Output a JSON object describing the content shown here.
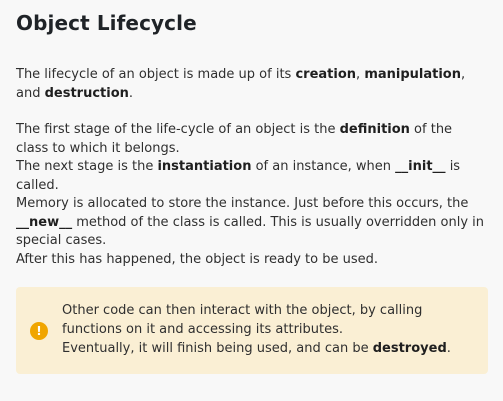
{
  "heading": "Object Lifecycle",
  "intro": {
    "t1": "The lifecycle of an object is made up of its ",
    "b1": "creation",
    "t2": ", ",
    "b2": "manipulation",
    "t3": ", and ",
    "b3": "destruction",
    "t4": "."
  },
  "stages": {
    "s1_t1": "The first stage of the life-cycle of an object is the ",
    "s1_b1": "definition",
    "s1_t2": " of the class to which it belongs.",
    "s2_t1": "The next stage is the ",
    "s2_b1": "instantiation",
    "s2_t2": " of an instance, when ",
    "s2_b2": "__init__",
    "s2_t3": " is called.",
    "s3_t1": "Memory is allocated to store the instance. Just before this occurs, the ",
    "s3_b1": "__new__",
    "s3_t2": " method of the class is called. This is usually overridden only in special cases.",
    "s4": "After this has happened, the object is ready to be used."
  },
  "callout": {
    "icon": "!",
    "icon_name": "warning-icon",
    "icon_color": "#f0a500",
    "background": "#faefd4",
    "l1": "Other code can then interact with the object, by calling functions on it and accessing its attributes.",
    "l2_t1": "Eventually, it will finish being used, and can be ",
    "l2_b1": "destroyed",
    "l2_t2": "."
  }
}
